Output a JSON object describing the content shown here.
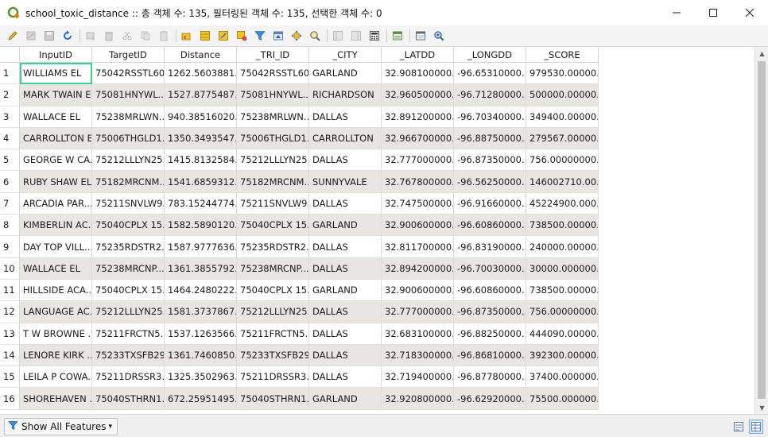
{
  "window": {
    "title": "school_toxic_distance :: 총 객체 수: 135, 필터링된 객체 수: 135, 선택한 객체 수: 0"
  },
  "toolbar": {
    "icons": [
      "pencil-icon",
      "multi-edit-icon",
      "save-icon",
      "reload-icon",
      "add-feature-icon",
      "delete-feature-icon",
      "cut-icon",
      "copy-icon",
      "paste-icon",
      "expression-select-icon",
      "select-all-icon",
      "invert-selection-icon",
      "deselect-icon",
      "filter-icon",
      "move-selection-top-icon",
      "pan-to-selection-icon",
      "zoom-to-selection-icon",
      "new-field-icon",
      "delete-field-icon",
      "field-calculator-icon",
      "conditional-format-icon",
      "dock-icon",
      "actions-icon"
    ]
  },
  "table": {
    "columns": [
      "InputID",
      "TargetID",
      "Distance",
      "_TRI_ID",
      "_CITY",
      "_LATDD",
      "_LONGDD",
      "_SCORE"
    ],
    "rows": [
      [
        "1",
        "WILLIAMS EL",
        "75042RSSTL60...",
        "1262.5603881...",
        "75042RSSTL60...",
        "GARLAND",
        "32.908100000...",
        "-96.65310000...",
        "979530.00000..."
      ],
      [
        "2",
        "MARK TWAIN EL",
        "75081HNYWL...",
        "1527.8775487...",
        "75081HNYWL...",
        "RICHARDSON",
        "32.960500000...",
        "-96.71280000...",
        "500000.00000..."
      ],
      [
        "3",
        "WALLACE EL",
        "75238MRLWN...",
        "940.38516020...",
        "75238MRLWN...",
        "DALLAS",
        "32.891200000...",
        "-96.70340000...",
        "349400.00000..."
      ],
      [
        "4",
        "CARROLLTON EL",
        "75006THGLD1...",
        "1350.3493547...",
        "75006THGLD1...",
        "CARROLLTON",
        "32.966700000...",
        "-96.88750000...",
        "279567.00000..."
      ],
      [
        "5",
        "GEORGE W CA...",
        "75212LLLYN25...",
        "1415.8132584...",
        "75212LLLYN25...",
        "DALLAS",
        "32.777000000...",
        "-96.87350000...",
        "756.00000000..."
      ],
      [
        "6",
        "RUBY SHAW EL",
        "75182MRCNM...",
        "1541.6859312...",
        "75182MRCNM...",
        "SUNNYVALE",
        "32.767800000...",
        "-96.56250000...",
        "146002710.00..."
      ],
      [
        "7",
        "ARCADIA PAR...",
        "75211SNVLW9...",
        "783.15244774...",
        "75211SNVLW9...",
        "DALLAS",
        "32.747500000...",
        "-96.91660000...",
        "45224900.000..."
      ],
      [
        "8",
        "KIMBERLIN AC...",
        "75040CPLX 15...",
        "1582.5890120...",
        "75040CPLX 15...",
        "GARLAND",
        "32.900600000...",
        "-96.60860000...",
        "738500.00000..."
      ],
      [
        "9",
        "DAY TOP VILL...",
        "75235RDSTR2...",
        "1587.9777636...",
        "75235RDSTR2...",
        "DALLAS",
        "32.811700000...",
        "-96.83190000...",
        "240000.00000..."
      ],
      [
        "10",
        "WALLACE EL",
        "75238MRCNP...",
        "1361.3855792...",
        "75238MRCNP...",
        "DALLAS",
        "32.894200000...",
        "-96.70030000...",
        "30000.000000..."
      ],
      [
        "11",
        "HILLSIDE ACA...",
        "75040CPLX 15...",
        "1464.2480222...",
        "75040CPLX 15...",
        "GARLAND",
        "32.900600000...",
        "-96.60860000...",
        "738500.00000..."
      ],
      [
        "12",
        "LANGUAGE AC...",
        "75212LLLYN25...",
        "1581.3737867...",
        "75212LLLYN25...",
        "DALLAS",
        "32.777000000...",
        "-96.87350000...",
        "756.00000000..."
      ],
      [
        "13",
        "T W BROWNE ...",
        "75211FRCTN5...",
        "1537.1263566...",
        "75211FRCTN5...",
        "DALLAS",
        "32.683100000...",
        "-96.88250000...",
        "444090.00000..."
      ],
      [
        "14",
        "LENORE KIRK ...",
        "75233TXSFB29...",
        "1361.7460850...",
        "75233TXSFB29...",
        "DALLAS",
        "32.718300000...",
        "-96.86810000...",
        "392300.00000..."
      ],
      [
        "15",
        "LEILA P COWA...",
        "75211DRSSR3...",
        "1325.3502963...",
        "75211DRSSR3...",
        "DALLAS",
        "32.719400000...",
        "-96.87780000...",
        "37400.000000..."
      ],
      [
        "16",
        "SHOREHAVEN ...",
        "75040STHRN1...",
        "672.25951495...",
        "75040STHRN1...",
        "GARLAND",
        "32.920800000...",
        "-96.62920000...",
        "75500.000000..."
      ]
    ]
  },
  "bottom": {
    "filter_button_label": "Show All Features"
  }
}
